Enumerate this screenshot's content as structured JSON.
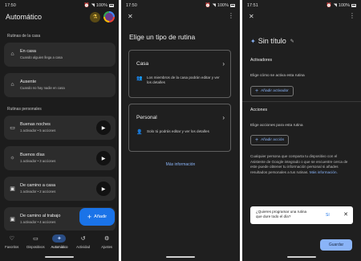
{
  "status_bars": [
    {
      "time": "17:50",
      "battery": "100%"
    },
    {
      "time": "17:50",
      "battery": "100%"
    },
    {
      "time": "17:51",
      "battery": "100%"
    }
  ],
  "screen1": {
    "title": "Automático",
    "home_section": "Rutinas de la casa",
    "home_routines": [
      {
        "title": "En casa",
        "subtitle": "Cuando alguien llega a casa",
        "icon": "home-icon"
      },
      {
        "title": "Ausente",
        "subtitle": "Cuando no hay nadie en casa",
        "icon": "home-away-icon"
      }
    ],
    "personal_section": "Rutinas personales",
    "personal_routines": [
      {
        "title": "Buenas noches",
        "subtitle": "1 activador • 5 acciones",
        "icon": "bed-icon"
      },
      {
        "title": "Buenos días",
        "subtitle": "1 activador • 3 acciones",
        "icon": "sun-icon"
      },
      {
        "title": "De camino a casa",
        "subtitle": "1 activador • 2 acciones",
        "icon": "car-icon"
      },
      {
        "title": "De camino al trabajo",
        "subtitle": "1 activador • 4 acciones",
        "icon": "car-icon"
      }
    ],
    "fab_label": "Añadir",
    "nav": [
      {
        "label": "Favoritos",
        "icon": "heart-icon",
        "active": false
      },
      {
        "label": "Dispositivos",
        "icon": "devices-icon",
        "active": false
      },
      {
        "label": "Automático",
        "icon": "sparkle-icon",
        "active": true
      },
      {
        "label": "Actividad",
        "icon": "history-icon",
        "active": false
      },
      {
        "label": "Ajustes",
        "icon": "gear-icon",
        "active": false
      }
    ]
  },
  "screen2": {
    "title": "Elige un tipo de rutina",
    "options": [
      {
        "title": "Casa",
        "description": "Los miembros de la casa podrán editar y ver los detalles"
      },
      {
        "title": "Personal",
        "description": "Solo tú podrás editar y ver los detalles"
      }
    ],
    "more_info": "Más información"
  },
  "screen3": {
    "title": "Sin título",
    "triggers_heading": "Activadores",
    "triggers_desc": "Elige cómo se activa esta rutina",
    "add_trigger": "Añadir activador",
    "actions_heading": "Acciones",
    "actions_desc": "Elige acciones para esta rutina",
    "add_action": "Añadir acción",
    "info_text": "Cualquier persona que comparta tu dispositivo con el Asistente de Google integrado o que se encuentre cerca de este puede obtener tu información personal si añades resultados personales a tus rutinas.",
    "info_link": "Más información.",
    "snackbar_text": "¿Quieres programar una rutina que dure todo el día?",
    "snackbar_yes": "Sí",
    "save": "Guardar"
  }
}
